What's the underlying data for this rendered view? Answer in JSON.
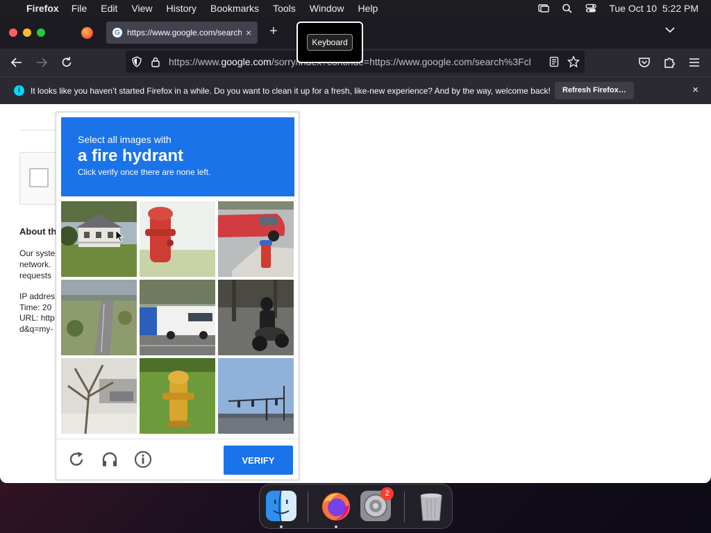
{
  "menubar": {
    "app_name": "Firefox",
    "menus": [
      "File",
      "Edit",
      "View",
      "History",
      "Bookmarks",
      "Tools",
      "Window",
      "Help"
    ],
    "datetime": "Tue Oct 10  5:22 PM"
  },
  "tab": {
    "title": "https://www.google.com/search",
    "close": "×",
    "new_tab": "+"
  },
  "tooltip": {
    "label": "Keyboard"
  },
  "urlbar": {
    "prefix": "https://www.",
    "domain": "google.com",
    "rest": "/sorry/index?continue=https://www.google.com/search%3Fcl"
  },
  "notification": {
    "message": "It looks like you haven’t started Firefox in a while. Do you want to clean it up for a fresh, like-new experience? And by the way, welcome back!",
    "button": "Refresh Firefox…",
    "close": "×"
  },
  "background_page": {
    "heading": "About th",
    "para_lines": [
      "Our syste",
      "network.",
      "requests"
    ],
    "info_lines": [
      "IP addres",
      "Time: 20",
      "URL: http",
      "d&q=my-"
    ]
  },
  "captcha": {
    "line1": "Select all images with",
    "line2": "a fire hydrant",
    "line3": "Click verify once there are none left.",
    "verify": "VERIFY",
    "tiles": [
      "house",
      "red-hydrant",
      "car-hydrant",
      "highway",
      "bus",
      "motorcycle",
      "tree",
      "yellow-hydrant",
      "traffic-lights"
    ]
  },
  "dock": {
    "badge": "2",
    "apps": [
      "finder",
      "firefox",
      "system-settings",
      "trash"
    ]
  }
}
